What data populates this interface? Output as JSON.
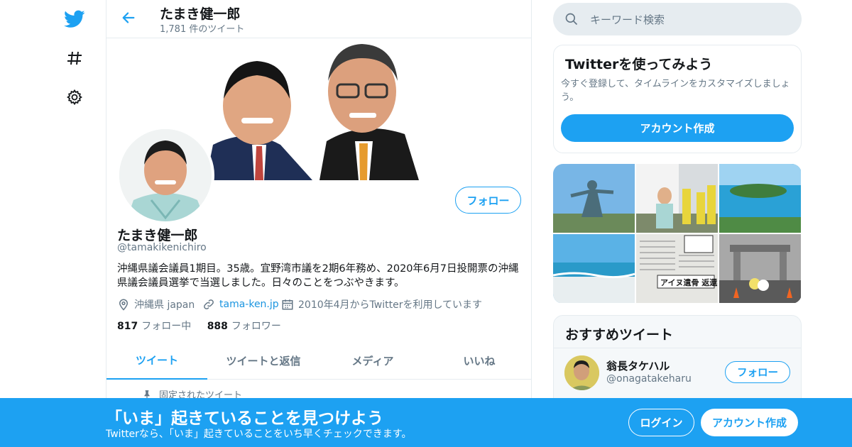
{
  "header": {
    "name": "たまき健一郎",
    "tweet_count": "1,781 件のツイート"
  },
  "profile": {
    "name": "たまき健一郎",
    "handle": "@tamakikenichiro",
    "bio": "沖縄県議会議員1期目。35歳。宜野湾市議を2期6年務め、2020年6月7日投開票の沖縄県議会議員選挙で当選しました。日々のことをつぶやきます。",
    "location": "沖縄県 japan",
    "website": "tama-ken.jp",
    "joined": "2010年4月からTwitterを利用しています",
    "following_count": "817",
    "following_label": "フォロー中",
    "followers_count": "888",
    "followers_label": "フォロワー",
    "follow_label": "フォロー"
  },
  "tabs": [
    {
      "label": "ツイート"
    },
    {
      "label": "ツイートと返信"
    },
    {
      "label": "メディア"
    },
    {
      "label": "いいね"
    }
  ],
  "pinned_label": "固定されたツイート",
  "search": {
    "placeholder": "キーワード検索"
  },
  "signup_card": {
    "title": "Twitterを使ってみよう",
    "description": "今すぐ登録して、タイムラインをカスタマイズしましょう。",
    "button": "アカウント作成"
  },
  "recommend": {
    "title": "おすすめツイート",
    "user_name": "翁長タケハル",
    "user_handle": "@onagatakeharu",
    "follow_label": "フォロー"
  },
  "bottom_banner": {
    "title": "「いま」起きていることを見つけよう",
    "subtitle": "Twitterなら、「いま」起きていることをいち早くチェックできます。",
    "login": "ログイン",
    "signup": "アカウント作成"
  },
  "media_tiles": {
    "newspaper_headline": "アイヌ遺骨 返還へ"
  },
  "colors": {
    "accent": "#1da1f2",
    "secondary_text": "#657786",
    "border": "#e6ecf0"
  },
  "icons": [
    "twitter-bird-icon",
    "hashtag-icon",
    "gear-icon",
    "back-arrow-icon",
    "search-icon",
    "location-icon",
    "link-icon",
    "calendar-icon",
    "pin-icon"
  ]
}
